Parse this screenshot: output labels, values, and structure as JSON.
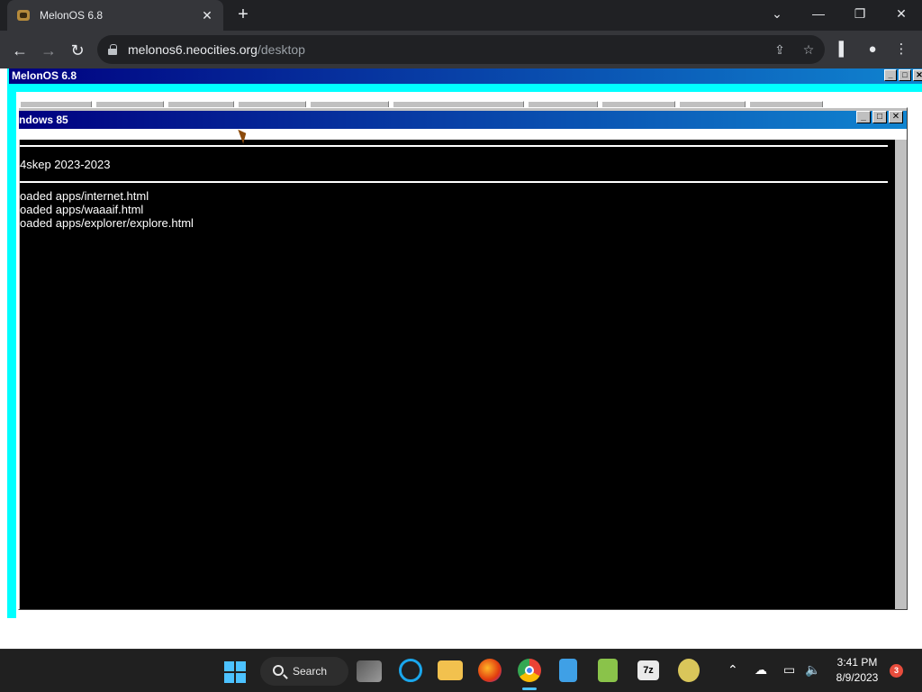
{
  "browser": {
    "tab_title": "MelonOS 6.8",
    "url_host": "melonos6.neocities.org",
    "url_path": "/desktop"
  },
  "melonos": {
    "window_title": "MelonOS 6.8"
  },
  "win85": {
    "title": "ndows 85",
    "lines": [
      "4skep 2023-2023",
      "oaded apps/internet.html",
      "oaded apps/waaaif.html",
      "oaded apps/explorer/explore.html"
    ]
  },
  "taskbar": {
    "search_label": "Search",
    "time": "3:41 PM",
    "date": "8/9/2023",
    "notification_count": "3"
  },
  "colors": {
    "desktop": "#00ffff",
    "titlebar_start": "#000080",
    "titlebar_end": "#1084d0",
    "console_bg": "#000000"
  }
}
